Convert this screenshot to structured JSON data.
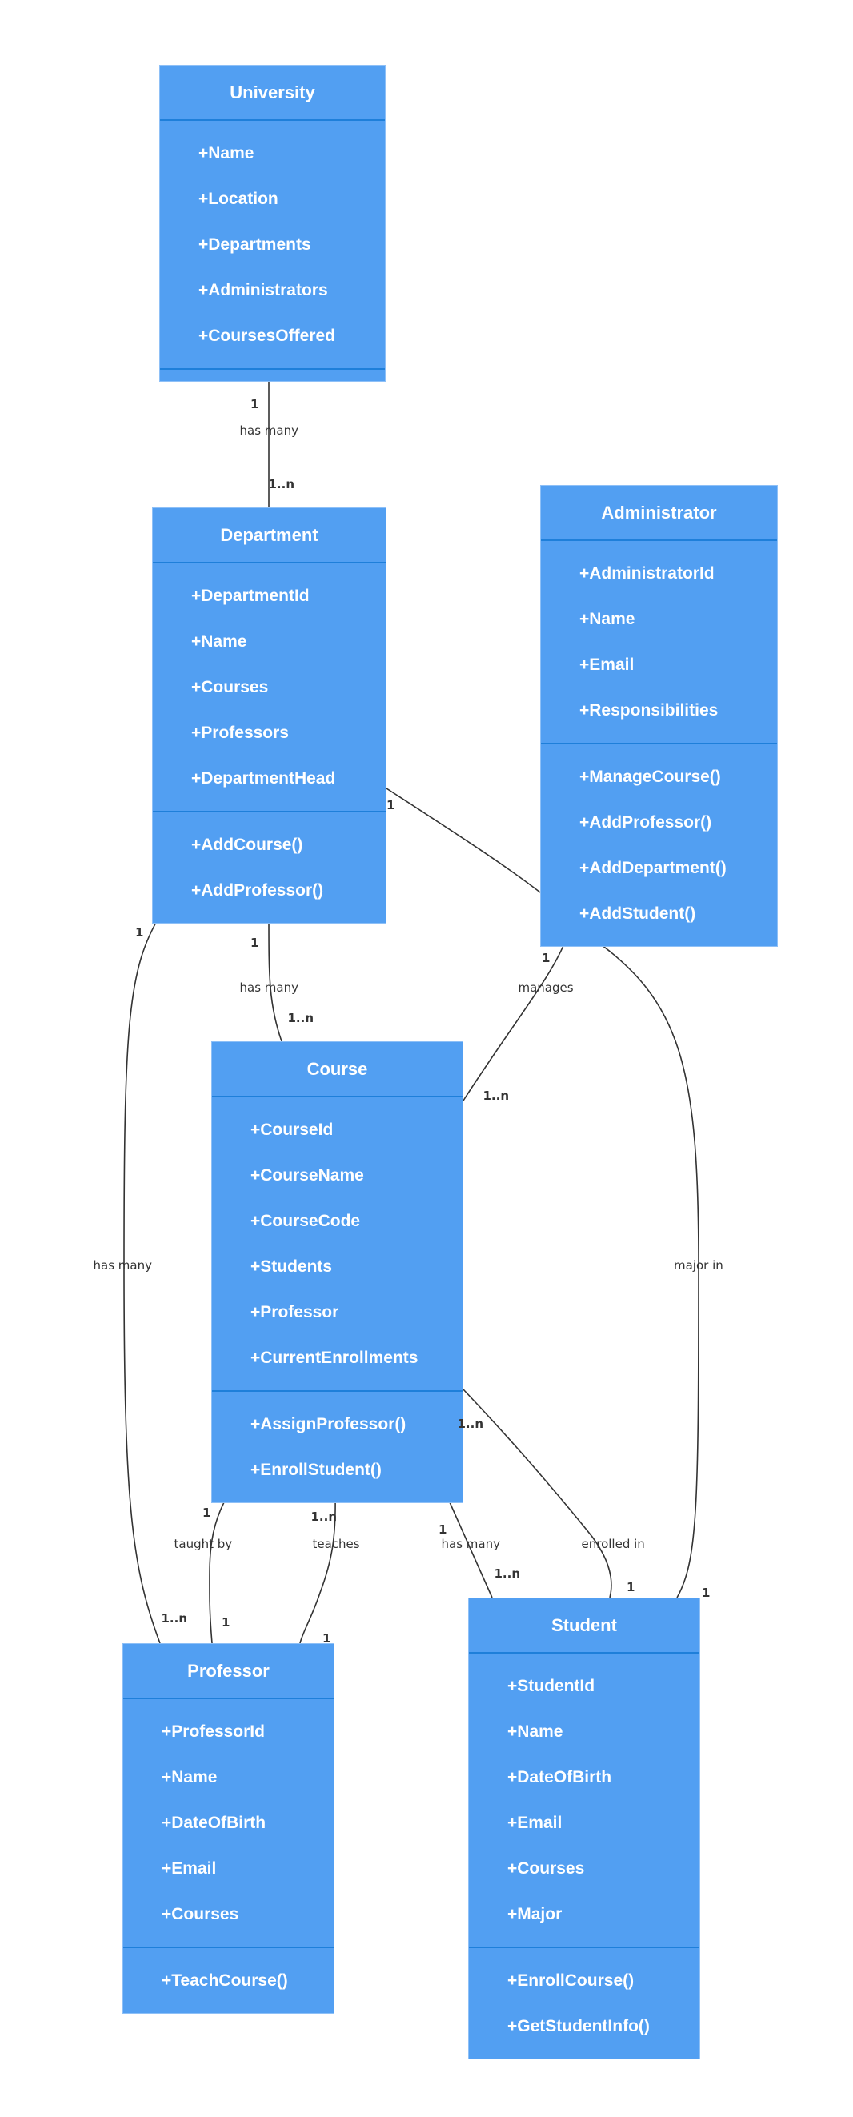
{
  "diagram": {
    "type": "uml-class-diagram",
    "colors": {
      "class_fill": "#529ff2",
      "class_border": "#8ec0f7",
      "divider": "#1e7fda",
      "text": "#ffffff",
      "line": "#333333"
    },
    "classes": [
      {
        "id": "university",
        "name": "University",
        "attributes": [
          "+Name",
          "+Location",
          "+Departments",
          "+Administrators",
          "+CoursesOffered"
        ],
        "methods": []
      },
      {
        "id": "department",
        "name": "Department",
        "attributes": [
          "+DepartmentId",
          "+Name",
          "+Courses",
          "+Professors",
          "+DepartmentHead"
        ],
        "methods": [
          "+AddCourse()",
          "+AddProfessor()"
        ]
      },
      {
        "id": "administrator",
        "name": "Administrator",
        "attributes": [
          "+AdministratorId",
          "+Name",
          "+Email",
          "+Responsibilities"
        ],
        "methods": [
          "+ManageCourse()",
          "+AddProfessor()",
          "+AddDepartment()",
          "+AddStudent()"
        ]
      },
      {
        "id": "course",
        "name": "Course",
        "attributes": [
          "+CourseId",
          "+CourseName",
          "+CourseCode",
          "+Students",
          "+Professor",
          "+CurrentEnrollments"
        ],
        "methods": [
          "+AssignProfessor()",
          "+EnrollStudent()"
        ]
      },
      {
        "id": "professor",
        "name": "Professor",
        "attributes": [
          "+ProfessorId",
          "+Name",
          "+DateOfBirth",
          "+Email",
          "+Courses"
        ],
        "methods": [
          "+TeachCourse()"
        ]
      },
      {
        "id": "student",
        "name": "Student",
        "attributes": [
          "+StudentId",
          "+Name",
          "+DateOfBirth",
          "+Email",
          "+Courses",
          "+Major"
        ],
        "methods": [
          "+EnrollCourse()",
          "+GetStudentInfo()"
        ]
      }
    ],
    "relationships": [
      {
        "id": "university-department",
        "from": "University",
        "to": "Department",
        "label": "has many",
        "from_mult": "1",
        "to_mult": "1..n"
      },
      {
        "id": "department-administrator",
        "from": "Department",
        "to": "Administrator",
        "label": "",
        "from_mult": "1",
        "to_mult": ""
      },
      {
        "id": "department-course",
        "from": "Department",
        "to": "Course",
        "label": "has many",
        "from_mult": "1",
        "to_mult": "1..n"
      },
      {
        "id": "department-professor",
        "from": "Department",
        "to": "Professor",
        "label": "has many",
        "from_mult": "1",
        "to_mult": "1..n"
      },
      {
        "id": "administrator-course",
        "from": "Administrator",
        "to": "Course",
        "label": "manages",
        "from_mult": "1",
        "to_mult": "1..n"
      },
      {
        "id": "administrator-student",
        "from": "Administrator",
        "to": "Student",
        "label": "major in",
        "from_mult": "",
        "to_mult": "1"
      },
      {
        "id": "course-professor-taughtby",
        "from": "Course",
        "to": "Professor",
        "label": "taught by",
        "from_mult": "1",
        "to_mult": "1"
      },
      {
        "id": "professor-course-teaches",
        "from": "Course",
        "to": "Professor",
        "label": "teaches",
        "from_mult": "1..n",
        "to_mult": "1"
      },
      {
        "id": "course-student-hasmany",
        "from": "Course",
        "to": "Student",
        "label": "has many",
        "from_mult": "1",
        "to_mult": "1..n"
      },
      {
        "id": "student-course-enrolled",
        "from": "Course",
        "to": "Student",
        "label": "enrolled in",
        "from_mult": "1..n",
        "to_mult": "1"
      }
    ]
  }
}
